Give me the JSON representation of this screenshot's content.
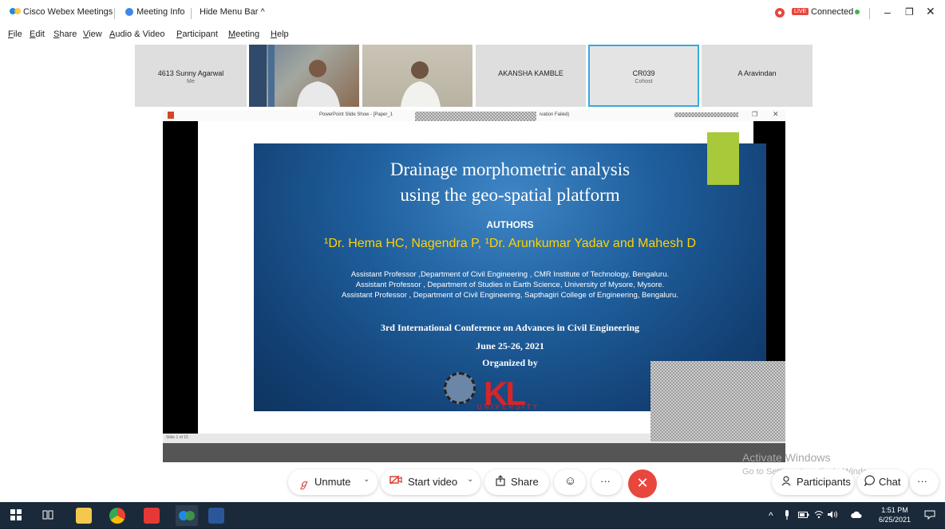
{
  "titlebar": {
    "app_name": "Cisco Webex Meetings",
    "meeting_info": "Meeting Info",
    "hide_menu": "Hide Menu Bar",
    "status": "Connected",
    "live_badge": "LIVE"
  },
  "menu": [
    "File",
    "Edit",
    "Share",
    "View",
    "Audio & Video",
    "Participant",
    "Meeting",
    "Help"
  ],
  "participants": [
    {
      "name": "4613 Sunny Agarwal",
      "role": "Me"
    },
    {
      "name": "",
      "role": ""
    },
    {
      "name": "",
      "role": ""
    },
    {
      "name": "AKANSHA KAMBLE",
      "role": ""
    },
    {
      "name": "CR039",
      "role": "Cohost"
    },
    {
      "name": "A Aravindan",
      "role": ""
    }
  ],
  "share": {
    "window_title": "PowerPoint Slide Show - [Paper_1",
    "window_title_tail": "ivation Failed)",
    "slide_status": "Slide 1 of 15"
  },
  "slide": {
    "title_line1": "Drainage morphometric analysis",
    "title_line2": "using the geo-spatial platform",
    "authors_heading": "AUTHORS",
    "authors": "¹Dr. Hema HC, Nagendra P, ¹Dr. Arunkumar Yadav and Mahesh D",
    "affiliations": [
      "Assistant Professor ,Department of Civil Engineering , CMR Institute of Technology, Bengaluru.",
      "Assistant Professor , Department of Studies in Earth Science, University of Mysore, Mysore.",
      "Assistant Professor , Department of Civil Engineering, Sapthagiri College of Engineering, Bengaluru."
    ],
    "conference": "3rd International Conference on Advances in Civil Engineering",
    "dates": "June 25-26, 2021",
    "organized_by": "Organized by",
    "logo_text": "KL",
    "logo_sub": "UNIVERSITY"
  },
  "watermark": {
    "line1": "Activate Windows",
    "line2": "Go to Settings to activate Windows."
  },
  "controls": {
    "unmute": "Unmute",
    "start_video": "Start video",
    "share": "Share",
    "more": "···",
    "end": "✕",
    "participants": "Participants",
    "chat": "Chat"
  },
  "taskbar": {
    "time": "1:51 PM",
    "date": "6/25/2021"
  },
  "colors": {
    "accent_blue": "#36a9e1",
    "end_red": "#e8473e",
    "slide_yellow": "#ffd200",
    "slide_green_block": "#a8c93a"
  }
}
